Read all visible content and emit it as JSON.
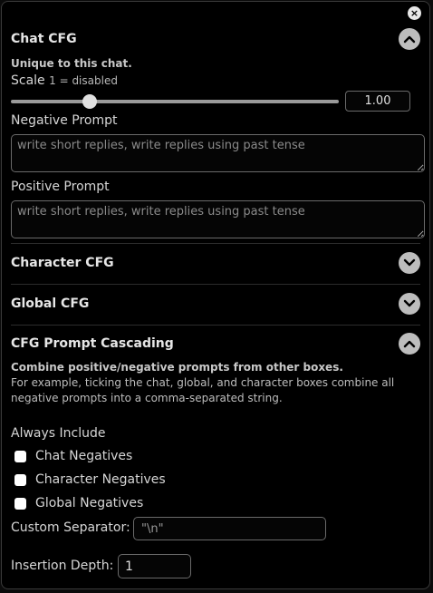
{
  "close_icon": "×",
  "chat_cfg": {
    "title": "Chat CFG",
    "subtitle": "Unique to this chat.",
    "scale_label": "Scale",
    "scale_hint": "1 = disabled",
    "scale_value": "1.00",
    "scale_fraction": 0.22,
    "negative_label": "Negative Prompt",
    "negative_placeholder": "write short replies, write replies using past tense",
    "positive_label": "Positive Prompt",
    "positive_placeholder": "write short replies, write replies using past tense",
    "expanded": true
  },
  "character_cfg": {
    "title": "Character CFG",
    "expanded": false
  },
  "global_cfg": {
    "title": "Global CFG",
    "expanded": false
  },
  "cascading": {
    "title": "CFG Prompt Cascading",
    "subtitle": "Combine positive/negative prompts from other boxes.",
    "description": "For example, ticking the chat, global, and character boxes combine all negative prompts into a comma-separated string.",
    "always_include_label": "Always Include",
    "checkboxes": [
      {
        "label": "Chat Negatives",
        "checked": false
      },
      {
        "label": "Character Negatives",
        "checked": false
      },
      {
        "label": "Global Negatives",
        "checked": false
      }
    ],
    "separator_label": "Custom Separator:",
    "separator_placeholder": "\"\\n\"",
    "depth_label": "Insertion Depth:",
    "depth_value": "1",
    "expanded": true
  },
  "colors": {
    "background": "#000000",
    "chevron_bg": "#bdbdbd",
    "text": "#dcdcdc"
  }
}
